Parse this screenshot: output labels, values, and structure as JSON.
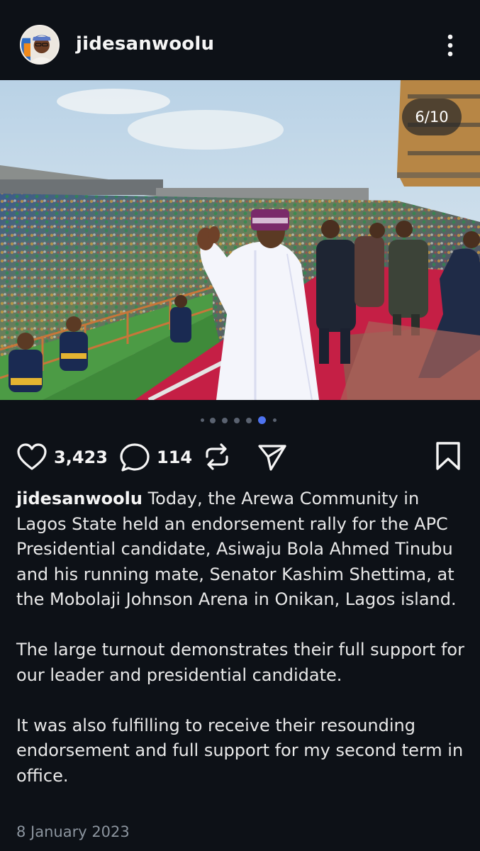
{
  "post": {
    "username": "jidesanwoolu",
    "counter": "6/10",
    "likes": "3,423",
    "comments": "114",
    "caption_paragraphs": [
      "Today, the Arewa Community in Lagos State held an endorsement rally for the APC Presidential candidate, Asiwaju Bola Ahmed Tinubu and his running mate, Senator Kashim Shettima, at the Mobolaji Johnson Arena in Onikan, Lagos island.",
      "The large turnout demonstrates their full support for our leader and presidential candidate.",
      "It was also fulfilling to receive their resounding endorsement and full support for my second term in office."
    ],
    "date": "8 January 2023",
    "carousel": {
      "total_dots": 7,
      "active_dot": 5
    }
  },
  "icons": {
    "more": "more-vertical-icon",
    "like": "heart-icon",
    "comment": "comment-bubble-icon",
    "repost": "repost-icon",
    "share": "send-icon",
    "save": "bookmark-icon"
  },
  "colors": {
    "background": "#0d1117",
    "text": "#f5f5f5",
    "muted": "#8b949e",
    "active_dot": "#4e73f0"
  }
}
